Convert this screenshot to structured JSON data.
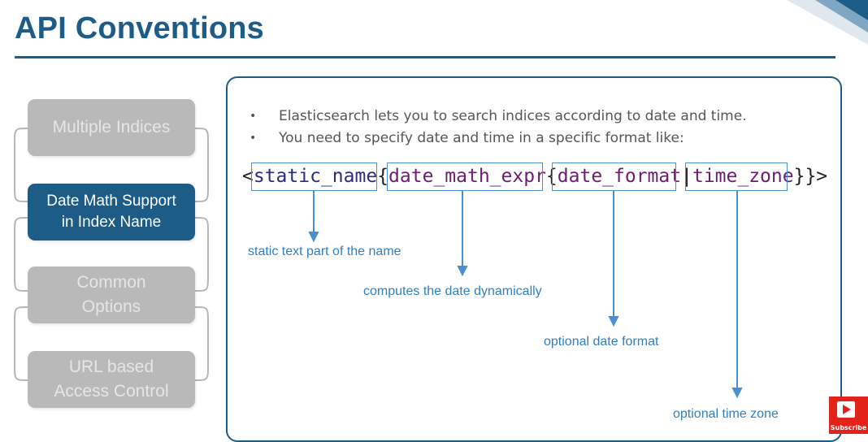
{
  "title": "API Conventions",
  "nav": {
    "items": [
      {
        "label": "Multiple Indices",
        "active": false
      },
      {
        "label": "Date Math Support in Index Name",
        "line1": "Date Math Support",
        "line2": "in Index Name",
        "active": true
      },
      {
        "label": "Common Options",
        "line1": "Common",
        "line2": "Options",
        "active": false
      },
      {
        "label": "URL based Access Control",
        "line1": "URL based",
        "line2": "Access Control",
        "active": false
      }
    ]
  },
  "content": {
    "bullets": [
      "Elasticsearch lets you to search indices according to date and time.",
      "You need to specify date and time in a specific format like:"
    ],
    "syntax": {
      "open": "<",
      "static_name": "static_name",
      "brace1": "{",
      "date_math_expr": "date_math_expr",
      "brace2": "{",
      "date_format": "date_format",
      "pipe": "|",
      "time_zone": "time_zone",
      "close": "}}>"
    },
    "callouts": {
      "static": "static text part of the name",
      "math": "computes the date dynamically",
      "format": "optional date format",
      "timezone": "optional time zone"
    }
  },
  "badge": {
    "label": "Subscribe"
  },
  "colors": {
    "brand": "#1d5c86",
    "accent": "#2f7fc0",
    "inactive": "#b9b9b9",
    "badge": "#e2231a"
  }
}
